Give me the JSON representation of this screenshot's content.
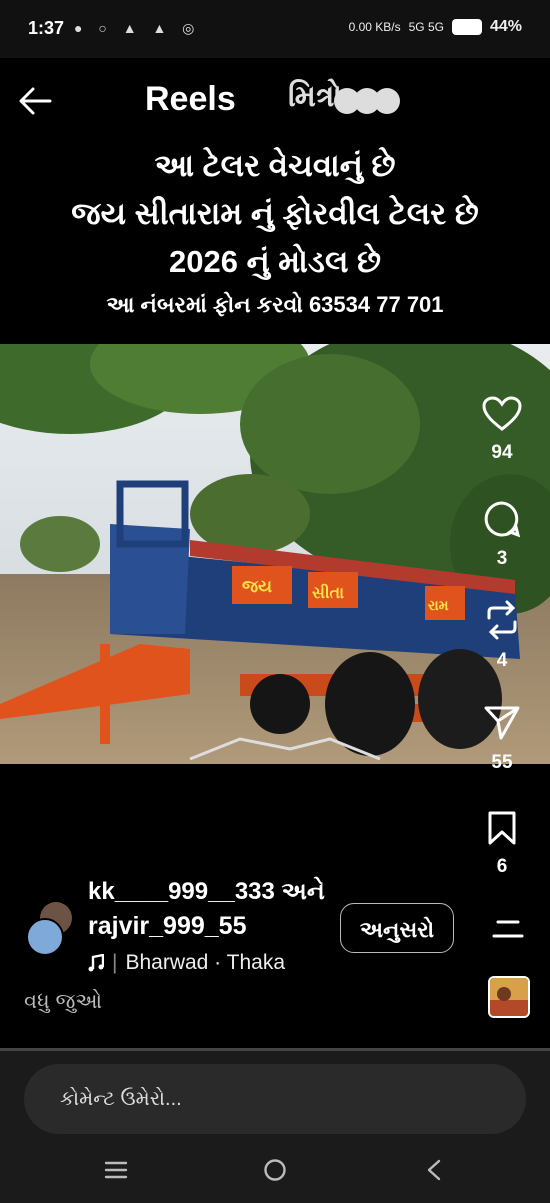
{
  "status": {
    "time": "1:37",
    "left_icons": "● ○ ▲ ▲ ◎",
    "net_speed": "0.00 KB/s",
    "signal": "5G 5G",
    "battery": "44%"
  },
  "header": {
    "back_icon": "arrow-left-icon",
    "title": "Reels",
    "brand": "મિત્રો"
  },
  "caption": {
    "line1": "આ ટેલર વેચવાનું છે",
    "line2": "જય સીતારામ નું ફોરવીલ ટેલર છે",
    "line3": "2026 નું મોડલ છે",
    "line4": "આ નંબરમાં ફોન કરવો 63534 77 701"
  },
  "trailer_text": [
    "જય",
    "સીતા",
    "રામ"
  ],
  "actions": {
    "likes": "94",
    "comments": "3",
    "reposts": "4",
    "shares": "55",
    "saves": "6"
  },
  "user": {
    "line1": "kk____999__333 અને",
    "line2": "rajvir_999_55",
    "follow_label": "અનુસરો",
    "music": "Bharwad · Thaka",
    "see_more": "વધુ જુઓ"
  },
  "comment": {
    "placeholder": "કોમેન્ટ ઉમેરો..."
  },
  "colors": {
    "background": "#000000",
    "trailer_blue": "#1f3f7a",
    "trailer_orange": "#e0531d"
  }
}
